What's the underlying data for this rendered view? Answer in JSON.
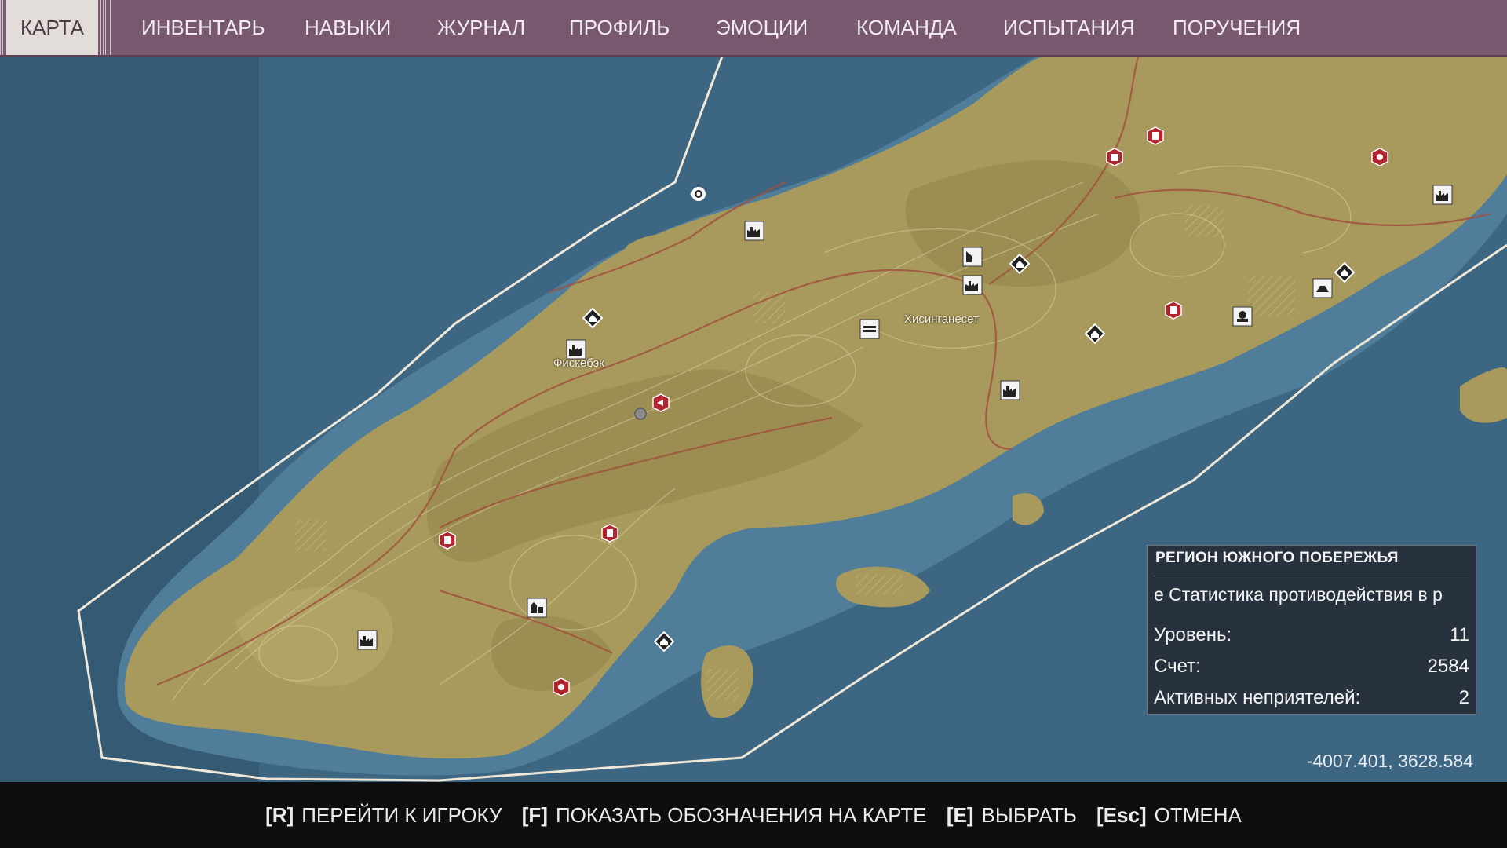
{
  "tabs": [
    {
      "label": "КАРТА",
      "active": true
    },
    {
      "label": "ИНВЕНТАРЬ"
    },
    {
      "label": "НАВЫКИ"
    },
    {
      "label": "ЖУРНАЛ"
    },
    {
      "label": "ПРОФИЛЬ"
    },
    {
      "label": "ЭМОЦИИ"
    },
    {
      "label": "КОМАНДА"
    },
    {
      "label": "ИСПЫТАНИЯ"
    },
    {
      "label": "ПОРУЧЕНИЯ"
    }
  ],
  "map": {
    "town_labels": {
      "fiskebak": "Фискебэк",
      "hisinganeset": "Хисинганесет"
    },
    "colors": {
      "sea_deep": "#3d6682",
      "sea_shallow": "#4f7d9a",
      "land": "#a89a5c",
      "accent_red": "#b3242e",
      "region_border": "#efe8d8"
    },
    "icons": [
      "player-marker-icon",
      "factory-icon",
      "safehouse-diamond-icon",
      "red-hexagon-icon",
      "bunker-icon",
      "checkpoint-icon"
    ]
  },
  "region": {
    "title": "РЕГИОН ЮЖНОГО ПОБЕРЕЖЬЯ",
    "ticker": "е   Статистика противодействия в р",
    "rows": [
      {
        "label": "Уровень:",
        "value": "11"
      },
      {
        "label": "Счет:",
        "value": "2584"
      },
      {
        "label": "Активных неприятелей:",
        "value": "2"
      }
    ]
  },
  "coordinates": "-4007.401, 3628.584",
  "hints": [
    {
      "key": "[R]",
      "label": "ПЕРЕЙТИ К ИГРОКУ"
    },
    {
      "key": "[F]",
      "label": "ПОКАЗАТЬ ОБОЗНАЧЕНИЯ НА КАРТЕ"
    },
    {
      "key": "[E]",
      "label": "ВЫБРАТЬ"
    },
    {
      "key": "[Esc]",
      "label": "ОТМЕНА"
    }
  ]
}
